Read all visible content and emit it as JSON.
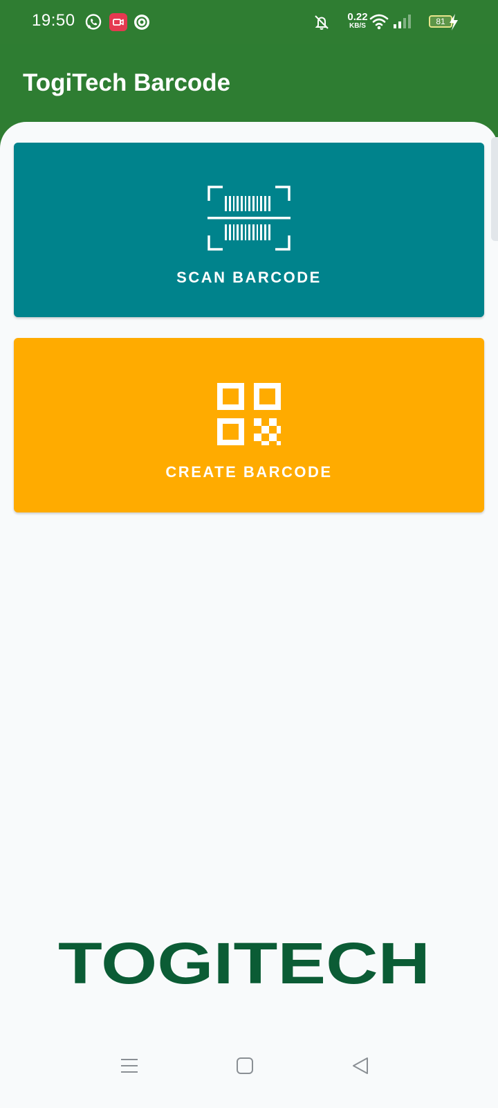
{
  "status_bar": {
    "time": "19:50",
    "net_speed": "0.22",
    "net_unit": "KB/S",
    "battery": "81",
    "icons": [
      "whatsapp-icon",
      "screen-record-icon",
      "sync-icon",
      "mute-icon",
      "wifi-icon",
      "signal-icon",
      "battery-icon",
      "charging-icon"
    ]
  },
  "app_bar": {
    "title": "TogiTech Barcode"
  },
  "cards": {
    "scan": {
      "label": "SCAN BARCODE",
      "icon": "barcode-scan-icon",
      "color": "#00838c"
    },
    "create": {
      "label": "CREATE BARCODE",
      "icon": "qr-code-icon",
      "color": "#ffab00"
    }
  },
  "brand": {
    "logo_text": "TOGITECH",
    "color": "#0b5c35"
  },
  "nav": {
    "items": [
      "menu-icon",
      "home-icon",
      "back-icon"
    ]
  },
  "colors": {
    "primary": "#2e7d32",
    "background": "#f8fafb"
  }
}
